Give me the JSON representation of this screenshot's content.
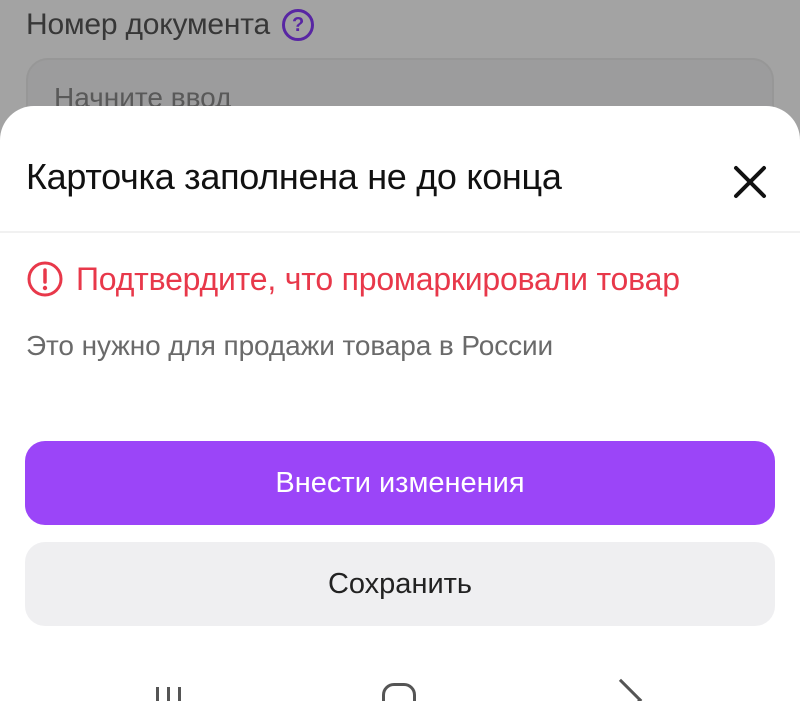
{
  "background_form": {
    "field_label": "Номер документа",
    "help_icon_glyph": "?",
    "field_placeholder": "Начните ввод"
  },
  "sheet": {
    "title": "Карточка заполнена не до конца",
    "close_icon": "close-icon",
    "error": {
      "icon": "exclamation-circle-icon",
      "text": "Подтвердите, что промаркировали товар"
    },
    "hint": "Это нужно для продажи товара в России",
    "primary_button": "Внести изменения",
    "secondary_button": "Сохранить"
  },
  "colors": {
    "accent": "#9b45f8",
    "error": "#e8384a",
    "secondary_bg": "#efeff1"
  },
  "navbar": {
    "icons": [
      "recent-apps-icon",
      "home-icon",
      "back-icon"
    ]
  }
}
